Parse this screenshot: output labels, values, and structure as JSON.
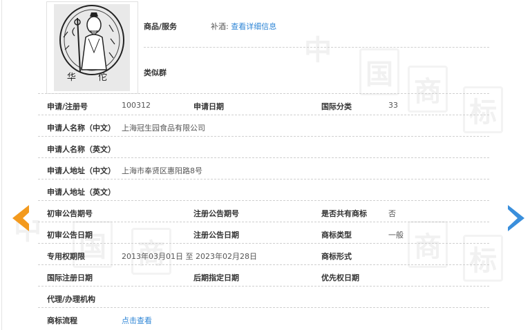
{
  "logo": {
    "caption": "华 佗"
  },
  "header": {
    "goods_label": "商品/服务",
    "goods_value": "补酒:",
    "goods_link": "查看详细信息",
    "similar_label": "类似群"
  },
  "rows": [
    {
      "label": "申请/注册号",
      "value": "100312",
      "label2": "申请日期",
      "value2": "",
      "label3": "国际分类",
      "value3": "33"
    },
    {
      "label": "申请人名称（中文）",
      "value": "上海冠生园食品有限公司"
    },
    {
      "label": "申请人名称（英文）",
      "value": ""
    },
    {
      "label": "申请人地址（中文）",
      "value": "上海市奉贤区惠阳路8号"
    },
    {
      "label": "申请人地址（英文）",
      "value": ""
    },
    {
      "label": "初审公告期号",
      "value": "",
      "label2": "注册公告期号",
      "value2": "",
      "label3": "是否共有商标",
      "value3": "否"
    },
    {
      "label": "初审公告日期",
      "value": "",
      "label2": "注册公告日期",
      "value2": "",
      "label3": "商标类型",
      "value3": "一般"
    },
    {
      "label": "专用权期限",
      "value": "2013年03月01日 至 2023年02月28日",
      "label2": "",
      "value2": "",
      "label3": "商标形式",
      "value3": ""
    },
    {
      "label": "国际注册日期",
      "value": "",
      "label2": "后期指定日期",
      "value2": "",
      "label3": "优先权日期",
      "value3": ""
    },
    {
      "label": "代理/办理机构",
      "value": ""
    },
    {
      "label": "商标流程",
      "value": "点击查看"
    }
  ],
  "watermark": [
    "中",
    "国",
    "商",
    "标"
  ],
  "nav": {
    "prev_icon": "chevron-left-icon",
    "next_icon": "chevron-right-icon",
    "prev_color": "#f39a1e",
    "next_color": "#3a8fdc"
  }
}
